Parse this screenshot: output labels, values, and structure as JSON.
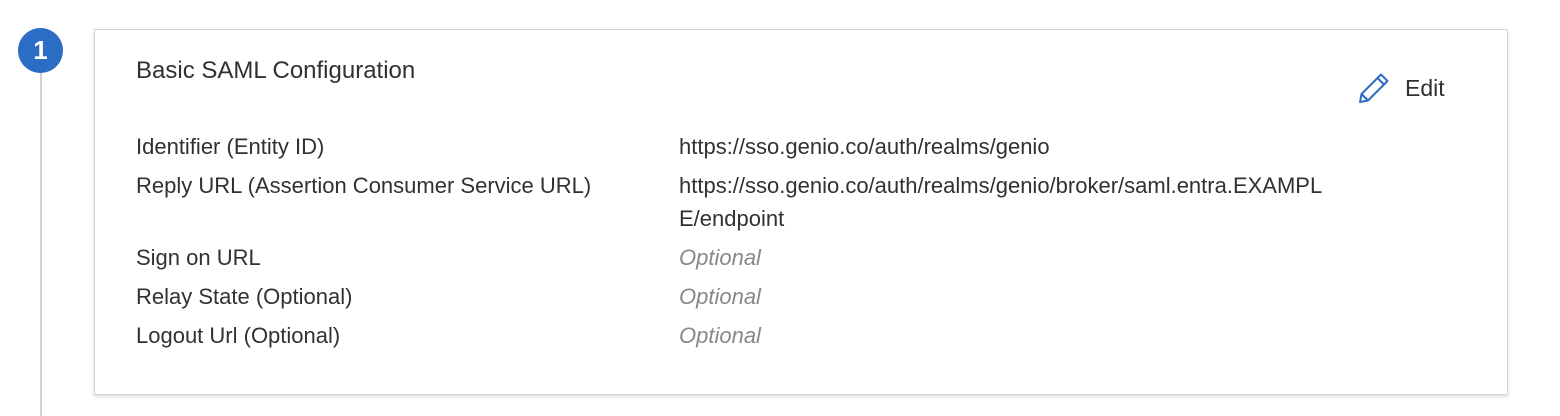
{
  "step": {
    "number": "1"
  },
  "section": {
    "title": "Basic SAML Configuration",
    "edit_label": "Edit"
  },
  "fields": [
    {
      "label": "Identifier (Entity ID)",
      "value": "https://sso.genio.co/auth/realms/genio",
      "is_placeholder": false
    },
    {
      "label": "Reply URL (Assertion Consumer Service URL)",
      "value": "https://sso.genio.co/auth/realms/genio/broker/saml.entra.EXAMPLE/endpoint",
      "is_placeholder": false
    },
    {
      "label": "Sign on URL",
      "value": "Optional",
      "is_placeholder": true
    },
    {
      "label": "Relay State (Optional)",
      "value": "Optional",
      "is_placeholder": true
    },
    {
      "label": "Logout Url (Optional)",
      "value": "Optional",
      "is_placeholder": true
    }
  ],
  "colors": {
    "accent": "#2b6cc4",
    "text": "#323130",
    "placeholder": "#8a8886",
    "border": "#d6d5d3"
  },
  "icons": {
    "edit": "pencil-icon"
  }
}
